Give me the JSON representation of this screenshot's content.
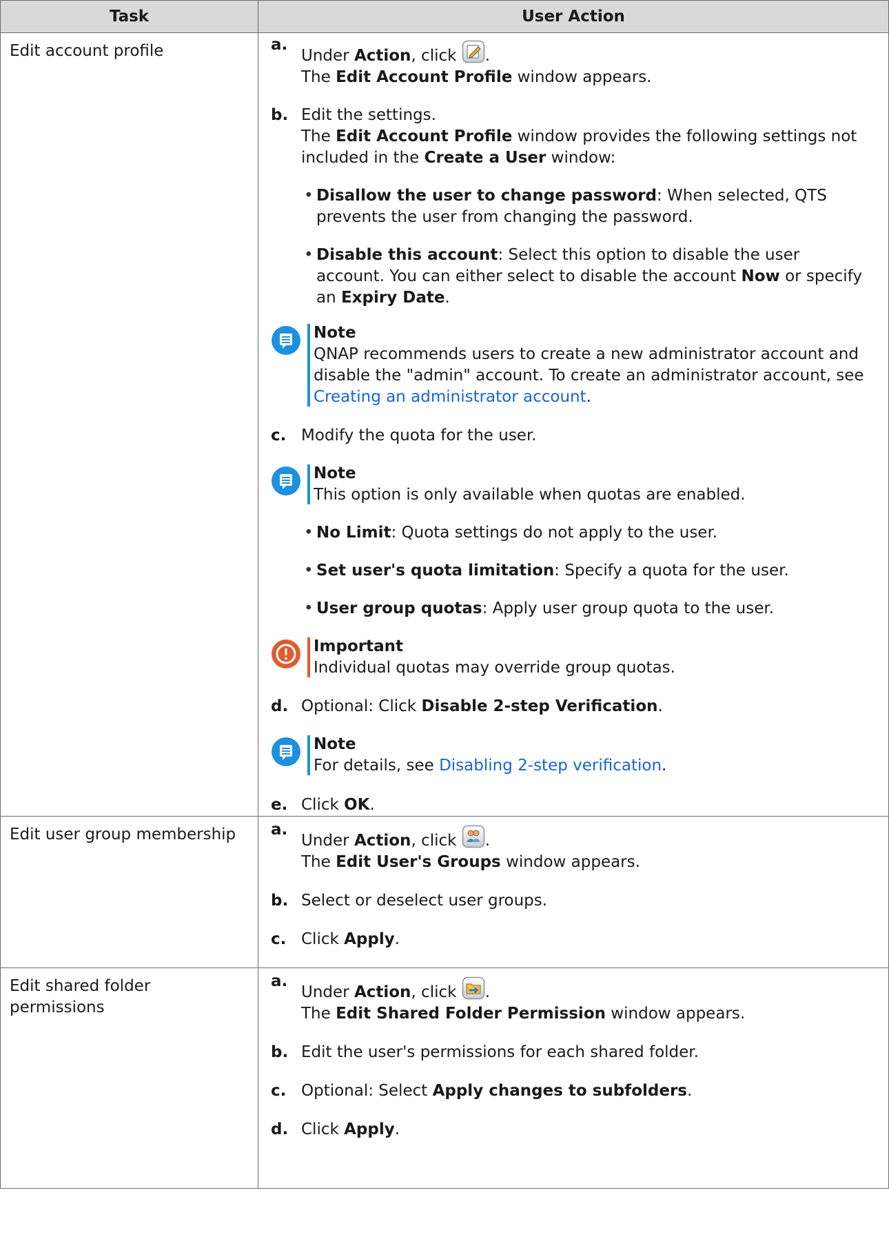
{
  "header": {
    "task": "Task",
    "user_action": "User Action"
  },
  "rows": [
    {
      "task": "Edit account profile",
      "steps": {
        "a": {
          "label": "a.",
          "under": "Under ",
          "action": "Action",
          "click": ", click ",
          "period": ".",
          "icon": "edit-pencil-icon",
          "line2_pre": "The ",
          "line2_bold": "Edit Account Profile",
          "line2_post": " window appears."
        },
        "b": {
          "label": "b.",
          "line1": "Edit the settings.",
          "line2_pre": "The ",
          "line2_bold1": "Edit Account Profile",
          "line2_mid": " window provides the following settings not included in the ",
          "line2_bold2": "Create a User",
          "line2_post": " window:",
          "bullet1_bold": "Disallow the user to change password",
          "bullet1_text": ": When selected, QTS prevents the user from changing the password.",
          "bullet2_bold": "Disable this account",
          "bullet2_text": ": Select this option to disable the user account. You can either select to disable the account ",
          "bullet2_now": "Now",
          "bullet2_or": " or specify an ",
          "bullet2_expiry": "Expiry Date",
          "bullet2_end": "."
        },
        "note1": {
          "head": "Note",
          "text": "QNAP recommends users to create a new administrator account and disable the \"admin\" account. To create an administrator account, see ",
          "link": "Creating an administrator account",
          "end": "."
        },
        "c": {
          "label": "c.",
          "text": "Modify the quota for the user."
        },
        "note2": {
          "head": "Note",
          "text": "This option is only available when quotas are enabled."
        },
        "quota_bullets": [
          {
            "bold": "No Limit",
            "text": ": Quota settings do not apply to the user."
          },
          {
            "bold": "Set user's quota limitation",
            "text": ": Specify a quota for the user."
          },
          {
            "bold": "User group quotas",
            "text": ": Apply user group quota to the user."
          }
        ],
        "important": {
          "head": "Important",
          "text": "Individual quotas may override group quotas."
        },
        "d": {
          "label": "d.",
          "pre": "Optional: Click ",
          "bold": "Disable 2-step Verification",
          "end": "."
        },
        "note3": {
          "head": "Note",
          "pre": "For details, see ",
          "link": "Disabling 2-step verification",
          "end": "."
        },
        "e": {
          "label": "e.",
          "pre": "Click ",
          "bold": "OK",
          "end": "."
        }
      }
    },
    {
      "task": "Edit user group membership",
      "steps": {
        "a": {
          "label": "a.",
          "under": "Under ",
          "action": "Action",
          "click": ", click ",
          "period": ".",
          "icon": "user-groups-icon",
          "line2_pre": "The ",
          "line2_bold": "Edit User's Groups",
          "line2_post": " window appears."
        },
        "b": {
          "label": "b.",
          "text": "Select or deselect user groups."
        },
        "c": {
          "label": "c.",
          "pre": "Click ",
          "bold": "Apply",
          "end": "."
        }
      }
    },
    {
      "task": "Edit shared folder permissions",
      "steps": {
        "a": {
          "label": "a.",
          "under": "Under ",
          "action": "Action",
          "click": ", click ",
          "period": ".",
          "icon": "shared-folder-icon",
          "line2_pre": "The ",
          "line2_bold": "Edit Shared Folder Permission",
          "line2_post": " window appears."
        },
        "b": {
          "label": "b.",
          "text": "Edit the user's permissions for each shared folder."
        },
        "c": {
          "label": "c.",
          "pre": "Optional: Select ",
          "bold": "Apply changes to subfolders",
          "end": "."
        },
        "d": {
          "label": "d.",
          "pre": "Click ",
          "bold": "Apply",
          "end": "."
        }
      }
    }
  ]
}
